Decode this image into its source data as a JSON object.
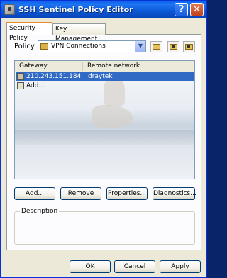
{
  "window": {
    "title": "SSH Sentinel Policy Editor",
    "help_label": "?",
    "close_label": "✕"
  },
  "tabs": [
    {
      "label": "Security Policy"
    },
    {
      "label": "Key Management"
    }
  ],
  "policy": {
    "label": "Policy :",
    "selected": "VPN Connections",
    "arrow": "▼"
  },
  "list": {
    "columns": [
      "Gateway",
      "Remote network"
    ],
    "rows": [
      {
        "gateway": "210.243.151.184",
        "remote": "draytek"
      }
    ],
    "add_item": "Add..."
  },
  "buttons": {
    "add": "Add...",
    "remove": "Remove",
    "properties": "Properties...",
    "diagnostics": "Diagnostics..."
  },
  "description": {
    "label": "Description"
  },
  "footer": {
    "ok": "OK",
    "cancel": "Cancel",
    "apply": "Apply"
  },
  "colors": {
    "selection": "#316ac5",
    "titlebar": "#0a5fe8",
    "close": "#c2401c"
  }
}
